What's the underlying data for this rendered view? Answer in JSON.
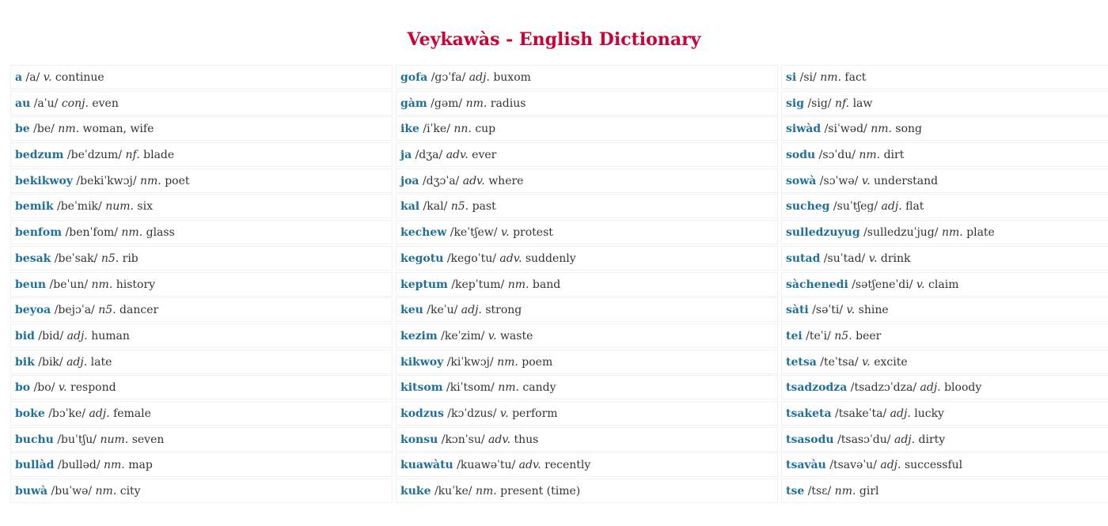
{
  "title": "Veykawàs - English Dictionary",
  "columns": [
    [
      {
        "word": "a",
        "pron": "/a/",
        "pos": "v.",
        "def": "continue"
      },
      {
        "word": "au",
        "pron": "/aˈu/",
        "pos": "conj.",
        "def": "even"
      },
      {
        "word": "be",
        "pron": "/be/",
        "pos": "nm.",
        "def": "woman, wife"
      },
      {
        "word": "bedzum",
        "pron": "/beˈdzum/",
        "pos": "nf.",
        "def": "blade"
      },
      {
        "word": "bekikwoy",
        "pron": "/bekiˈkwɔj/",
        "pos": "nm.",
        "def": "poet"
      },
      {
        "word": "bemik",
        "pron": "/beˈmik/",
        "pos": "num.",
        "def": "six"
      },
      {
        "word": "benfom",
        "pron": "/benˈfom/",
        "pos": "nm.",
        "def": "glass"
      },
      {
        "word": "besak",
        "pron": "/beˈsak/",
        "pos": "n5.",
        "def": "rib"
      },
      {
        "word": "beun",
        "pron": "/beˈun/",
        "pos": "nm.",
        "def": "history"
      },
      {
        "word": "beyoa",
        "pron": "/bejɔˈa/",
        "pos": "n5.",
        "def": "dancer"
      },
      {
        "word": "bid",
        "pron": "/bid/",
        "pos": "adj.",
        "def": "human"
      },
      {
        "word": "bik",
        "pron": "/bik/",
        "pos": "adj.",
        "def": "late"
      },
      {
        "word": "bo",
        "pron": "/bo/",
        "pos": "v.",
        "def": "respond"
      },
      {
        "word": "boke",
        "pron": "/bɔˈke/",
        "pos": "adj.",
        "def": "female"
      },
      {
        "word": "buchu",
        "pron": "/buˈtʃu/",
        "pos": "num.",
        "def": "seven"
      },
      {
        "word": "bullàd",
        "pron": "/bulləd/",
        "pos": "nm.",
        "def": "map"
      },
      {
        "word": "buwà",
        "pron": "/buˈwə/",
        "pos": "nm.",
        "def": "city"
      }
    ],
    [
      {
        "word": "gofa",
        "pron": "/gɔˈfa/",
        "pos": "adj.",
        "def": "buxom"
      },
      {
        "word": "gàm",
        "pron": "/gəm/",
        "pos": "nm.",
        "def": "radius"
      },
      {
        "word": "ike",
        "pron": "/iˈke/",
        "pos": "nn.",
        "def": "cup"
      },
      {
        "word": "ja",
        "pron": "/dʒa/",
        "pos": "adv.",
        "def": "ever"
      },
      {
        "word": "joa",
        "pron": "/dʒɔˈa/",
        "pos": "adv.",
        "def": "where"
      },
      {
        "word": "kal",
        "pron": "/kal/",
        "pos": "n5.",
        "def": "past"
      },
      {
        "word": "kechew",
        "pron": "/keˈtʃew/",
        "pos": "v.",
        "def": "protest"
      },
      {
        "word": "kegotu",
        "pron": "/kegoˈtu/",
        "pos": "adv.",
        "def": "suddenly"
      },
      {
        "word": "keptum",
        "pron": "/kepˈtum/",
        "pos": "nm.",
        "def": "band"
      },
      {
        "word": "keu",
        "pron": "/keˈu/",
        "pos": "adj.",
        "def": "strong"
      },
      {
        "word": "kezim",
        "pron": "/keˈzim/",
        "pos": "v.",
        "def": "waste"
      },
      {
        "word": "kikwoy",
        "pron": "/kiˈkwɔj/",
        "pos": "nm.",
        "def": "poem"
      },
      {
        "word": "kitsom",
        "pron": "/kiˈtsom/",
        "pos": "nm.",
        "def": "candy"
      },
      {
        "word": "kodzus",
        "pron": "/kɔˈdzus/",
        "pos": "v.",
        "def": "perform"
      },
      {
        "word": "konsu",
        "pron": "/kɔnˈsu/",
        "pos": "adv.",
        "def": "thus"
      },
      {
        "word": "kuawàtu",
        "pron": "/kuawəˈtu/",
        "pos": "adv.",
        "def": "recently"
      },
      {
        "word": "kuke",
        "pron": "/kuˈke/",
        "pos": "nm.",
        "def": "present (time)"
      }
    ],
    [
      {
        "word": "si",
        "pron": "/si/",
        "pos": "nm.",
        "def": "fact"
      },
      {
        "word": "sig",
        "pron": "/sig/",
        "pos": "nf.",
        "def": "law"
      },
      {
        "word": "siwàd",
        "pron": "/siˈwəd/",
        "pos": "nm.",
        "def": "song"
      },
      {
        "word": "sodu",
        "pron": "/sɔˈdu/",
        "pos": "nm.",
        "def": "dirt"
      },
      {
        "word": "sowà",
        "pron": "/sɔˈwə/",
        "pos": "v.",
        "def": "understand"
      },
      {
        "word": "sucheg",
        "pron": "/suˈtʃeg/",
        "pos": "adj.",
        "def": "flat"
      },
      {
        "word": "sulledzuyug",
        "pron": "/sulledzuˈjug/",
        "pos": "nm.",
        "def": "plate"
      },
      {
        "word": "sutad",
        "pron": "/suˈtad/",
        "pos": "v.",
        "def": "drink"
      },
      {
        "word": "sàchenedi",
        "pron": "/sətʃeneˈdi/",
        "pos": "v.",
        "def": "claim"
      },
      {
        "word": "sàti",
        "pron": "/səˈti/",
        "pos": "v.",
        "def": "shine"
      },
      {
        "word": "tei",
        "pron": "/teˈi/",
        "pos": "n5.",
        "def": "beer"
      },
      {
        "word": "tetsa",
        "pron": "/teˈtsa/",
        "pos": "v.",
        "def": "excite"
      },
      {
        "word": "tsadzodza",
        "pron": "/tsadzɔˈdza/",
        "pos": "adj.",
        "def": "bloody"
      },
      {
        "word": "tsaketa",
        "pron": "/tsakeˈta/",
        "pos": "adj.",
        "def": "lucky"
      },
      {
        "word": "tsasodu",
        "pron": "/tsasɔˈdu/",
        "pos": "adj.",
        "def": "dirty"
      },
      {
        "word": "tsavàu",
        "pron": "/tsavəˈu/",
        "pos": "adj.",
        "def": "successful"
      },
      {
        "word": "tse",
        "pron": "/tsɛ/",
        "pos": "nm.",
        "def": "girl"
      }
    ]
  ]
}
